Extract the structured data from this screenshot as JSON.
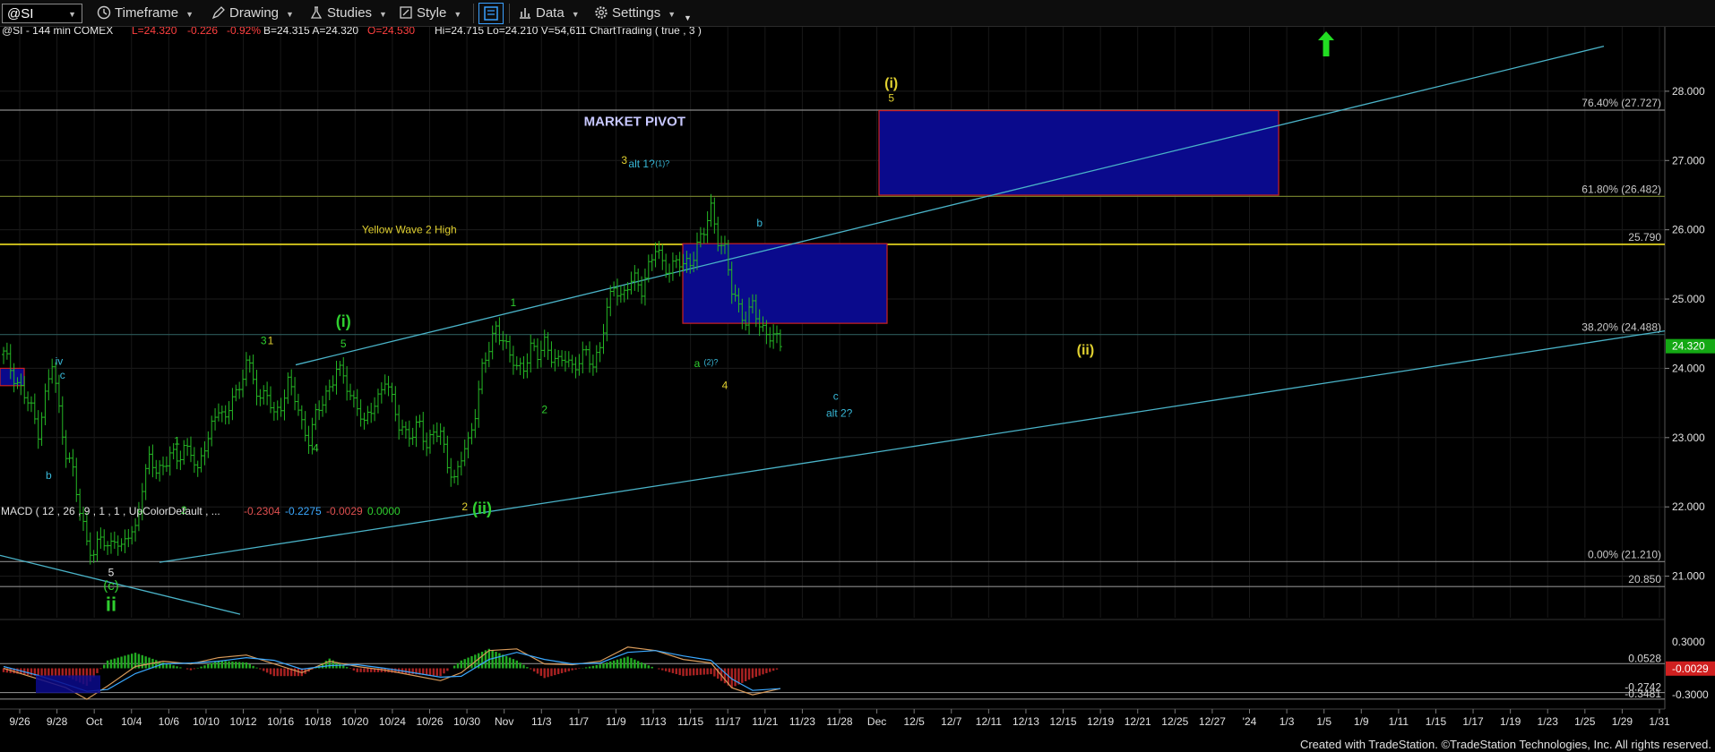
{
  "toolbar": {
    "symbol": "@SI",
    "timeframe": "Timeframe",
    "drawing": "Drawing",
    "studies": "Studies",
    "style": "Style",
    "data": "Data",
    "settings": "Settings"
  },
  "header": {
    "info": "@SI - 144 min  COMEX",
    "last": "L=24.320",
    "change": "-0.226",
    "pct": "-0.92%",
    "rest": "B=24.315  A=24.320",
    "open": "O=24.530",
    "tail": "Hi=24.715  Lo=24.210  V=54,611  ChartTrading ( true , 3 )"
  },
  "macd_header": {
    "label": "MACD ( 12 , 26 , 9 , 1 , 1 , UpColorDefault , ...",
    "v1": "-0.2304",
    "v2": "-0.2275",
    "v3": "-0.0029",
    "v4": "0.0000"
  },
  "footer": "Created with TradeStation. ©TradeStation Technologies, Inc. All rights reserved.",
  "colors": {
    "candle": "#25b825",
    "accent_yellow": "#f0e020",
    "pivot_fill": "#0a0a8c",
    "pivot_border": "#cc2222",
    "trendline": "#4ab3c8",
    "label_green": "#2fcf2f",
    "label_cyan": "#38b8d8",
    "label_yellow": "#e0d030"
  },
  "chart_data": {
    "type": "candlestick",
    "symbol": "@SI",
    "ylim": [
      20.4,
      28.8
    ],
    "y_ticks": [
      21.0,
      22.0,
      23.0,
      24.0,
      25.0,
      26.0,
      27.0,
      28.0
    ],
    "y_tick_labels": [
      "21.000",
      "22.000",
      "23.000",
      "24.000",
      "25.000",
      "26.000",
      "27.000",
      "28.000"
    ],
    "x_labels": [
      "9/26",
      "9/28",
      "Oct",
      "10/4",
      "10/6",
      "10/10",
      "10/12",
      "10/16",
      "10/18",
      "10/20",
      "10/24",
      "10/26",
      "10/30",
      "Nov",
      "11/3",
      "11/7",
      "11/9",
      "11/13",
      "11/15",
      "11/17",
      "11/21",
      "11/23",
      "11/28",
      "Dec",
      "12/5",
      "12/7",
      "12/11",
      "12/13",
      "12/15",
      "12/19",
      "12/21",
      "12/25",
      "12/27",
      "'24",
      "1/3",
      "1/5",
      "1/9",
      "1/11",
      "1/15",
      "1/17",
      "1/19",
      "1/23",
      "1/25",
      "1/29",
      "1/31"
    ],
    "price_path": [
      [
        0,
        24.2
      ],
      [
        2,
        24.0
      ],
      [
        4,
        23.8
      ],
      [
        6,
        23.6
      ],
      [
        8,
        23.4
      ],
      [
        10,
        23.1
      ],
      [
        12,
        23.6
      ],
      [
        14,
        24.05
      ],
      [
        16,
        23.4
      ],
      [
        18,
        22.8
      ],
      [
        20,
        22.5
      ],
      [
        22,
        21.9
      ],
      [
        24,
        21.55
      ],
      [
        26,
        21.3
      ],
      [
        28,
        21.55
      ],
      [
        30,
        21.4
      ],
      [
        32,
        21.6
      ],
      [
        34,
        21.35
      ],
      [
        36,
        21.6
      ],
      [
        38,
        21.7
      ],
      [
        40,
        22.3
      ],
      [
        42,
        22.65
      ],
      [
        44,
        22.55
      ],
      [
        46,
        22.6
      ],
      [
        48,
        22.75
      ],
      [
        50,
        22.65
      ],
      [
        52,
        22.9
      ],
      [
        54,
        22.8
      ],
      [
        56,
        22.45
      ],
      [
        58,
        22.9
      ],
      [
        60,
        23.2
      ],
      [
        62,
        23.4
      ],
      [
        64,
        23.2
      ],
      [
        66,
        23.7
      ],
      [
        68,
        23.65
      ],
      [
        70,
        24.1
      ],
      [
        72,
        23.85
      ],
      [
        74,
        23.6
      ],
      [
        76,
        23.6
      ],
      [
        78,
        23.3
      ],
      [
        80,
        23.5
      ],
      [
        82,
        23.8
      ],
      [
        84,
        23.55
      ],
      [
        86,
        23.2
      ],
      [
        88,
        23.0
      ],
      [
        90,
        23.3
      ],
      [
        92,
        23.5
      ],
      [
        94,
        23.75
      ],
      [
        96,
        24.0
      ],
      [
        98,
        23.85
      ],
      [
        100,
        23.6
      ],
      [
        102,
        23.5
      ],
      [
        104,
        23.15
      ],
      [
        106,
        23.4
      ],
      [
        108,
        23.6
      ],
      [
        110,
        23.85
      ],
      [
        112,
        23.5
      ],
      [
        114,
        23.2
      ],
      [
        116,
        23.1
      ],
      [
        118,
        23.0
      ],
      [
        120,
        23.2
      ],
      [
        122,
        22.9
      ],
      [
        124,
        23.1
      ],
      [
        126,
        23.0
      ],
      [
        128,
        22.65
      ],
      [
        130,
        22.4
      ],
      [
        132,
        22.7
      ],
      [
        134,
        22.9
      ],
      [
        136,
        23.4
      ],
      [
        138,
        24.0
      ],
      [
        140,
        24.25
      ],
      [
        142,
        24.6
      ],
      [
        144,
        24.45
      ],
      [
        146,
        24.15
      ],
      [
        148,
        24.0
      ],
      [
        150,
        24.05
      ],
      [
        152,
        24.3
      ],
      [
        154,
        24.15
      ],
      [
        156,
        24.4
      ],
      [
        158,
        24.2
      ],
      [
        160,
        24.05
      ],
      [
        162,
        24.15
      ],
      [
        164,
        24.05
      ],
      [
        166,
        24.1
      ],
      [
        168,
        24.2
      ],
      [
        170,
        24.05
      ],
      [
        172,
        24.35
      ],
      [
        174,
        24.8
      ],
      [
        176,
        25.2
      ],
      [
        178,
        25.05
      ],
      [
        180,
        25.2
      ],
      [
        182,
        25.25
      ],
      [
        184,
        25.15
      ],
      [
        186,
        25.5
      ],
      [
        188,
        25.7
      ],
      [
        190,
        25.5
      ],
      [
        192,
        25.45
      ],
      [
        194,
        25.55
      ],
      [
        196,
        25.45
      ],
      [
        198,
        25.55
      ],
      [
        200,
        25.8
      ],
      [
        202,
        25.95
      ],
      [
        204,
        26.3
      ],
      [
        206,
        25.9
      ],
      [
        208,
        25.7
      ],
      [
        210,
        25.1
      ],
      [
        212,
        24.9
      ],
      [
        214,
        24.7
      ],
      [
        216,
        24.9
      ],
      [
        218,
        24.6
      ],
      [
        220,
        24.55
      ],
      [
        222,
        24.45
      ],
      [
        224,
        24.32
      ]
    ],
    "bar_count": 225,
    "horizontal_levels": [
      {
        "price": 27.727,
        "label": "76.40% (27.727)",
        "color": "#8a8a8a"
      },
      {
        "price": 26.482,
        "label": "61.80% (26.482)",
        "color": "#6e7a2a"
      },
      {
        "price": 25.79,
        "label": "25.790",
        "color": "#f0e020"
      },
      {
        "price": 24.488,
        "label": "38.20% (24.488)",
        "color": "#2b5a5a"
      },
      {
        "price": 21.21,
        "label": "0.00% (21.210)",
        "color": "#8a8a8a"
      },
      {
        "price": 20.85,
        "label": "20.850",
        "color": "#8a8a8a"
      }
    ],
    "last_price": "24.320",
    "annotations": [
      {
        "text": "MARKET PIVOT",
        "color": "#c8c8ff",
        "size": 15,
        "bold": true,
        "price": 27.5,
        "bar": 182
      },
      {
        "text": "Yellow Wave 2 High",
        "color": "#e0d030",
        "size": 12,
        "price": 25.95,
        "bar": 117
      },
      {
        "text": "(i)",
        "color": "#e0d030",
        "size": 16,
        "bold": true,
        "price": 28.05,
        "bar": 256
      },
      {
        "text": "5",
        "color": "#e0d030",
        "size": 12,
        "price": 27.85,
        "bar": 256
      },
      {
        "text": "3",
        "color": "#e0d030",
        "size": 12,
        "price": 26.95,
        "bar": 179
      },
      {
        "text": "alt 1?",
        "color": "#38b8d8",
        "size": 12,
        "price": 26.9,
        "bar": 184
      },
      {
        "text": "(1)?",
        "color": "#38b8d8",
        "size": 9,
        "price": 26.92,
        "bar": 190
      },
      {
        "text": "b",
        "color": "#38b8d8",
        "size": 12,
        "price": 26.05,
        "bar": 218
      },
      {
        "text": "1",
        "color": "#2fcf2f",
        "size": 12,
        "price": 24.9,
        "bar": 147
      },
      {
        "text": "a",
        "color": "#2fcf2f",
        "size": 12,
        "price": 24.02,
        "bar": 200
      },
      {
        "text": "(2)?",
        "color": "#38b8d8",
        "size": 9,
        "price": 24.05,
        "bar": 204
      },
      {
        "text": "4",
        "color": "#e0d030",
        "size": 12,
        "price": 23.7,
        "bar": 208
      },
      {
        "text": "c",
        "color": "#38b8d8",
        "size": 12,
        "price": 23.55,
        "bar": 240
      },
      {
        "text": "alt 2?",
        "color": "#38b8d8",
        "size": 12,
        "price": 23.3,
        "bar": 241
      },
      {
        "text": "(ii)",
        "color": "#e0d030",
        "size": 16,
        "bold": true,
        "price": 24.2,
        "bar": 312
      },
      {
        "text": "2",
        "color": "#2fcf2f",
        "size": 12,
        "price": 23.35,
        "bar": 156
      },
      {
        "text": "2",
        "color": "#e0d030",
        "size": 12,
        "price": 21.95,
        "bar": 133
      },
      {
        "text": "(ii)",
        "color": "#2fcf2f",
        "size": 18,
        "bold": true,
        "price": 21.9,
        "bar": 138
      },
      {
        "text": "(i)",
        "color": "#2fcf2f",
        "size": 18,
        "bold": true,
        "price": 24.6,
        "bar": 98
      },
      {
        "text": "5",
        "color": "#2fcf2f",
        "size": 12,
        "price": 24.3,
        "bar": 98
      },
      {
        "text": "3",
        "color": "#2fcf2f",
        "size": 12,
        "price": 24.35,
        "bar": 75
      },
      {
        "text": "1",
        "color": "#e0d030",
        "size": 12,
        "price": 24.35,
        "bar": 77
      },
      {
        "text": "4",
        "color": "#2fcf2f",
        "size": 12,
        "price": 22.8,
        "bar": 90
      },
      {
        "text": "1",
        "color": "#2fcf2f",
        "size": 12,
        "price": 22.9,
        "bar": 50
      },
      {
        "text": "2",
        "color": "#2fcf2f",
        "size": 12,
        "price": 21.9,
        "bar": 52
      },
      {
        "text": "iv",
        "color": "#38b8d8",
        "size": 12,
        "price": 24.05,
        "bar": 16
      },
      {
        "text": "c",
        "color": "#38b8d8",
        "size": 12,
        "price": 23.85,
        "bar": 17
      },
      {
        "text": "b",
        "color": "#38b8d8",
        "size": 12,
        "price": 22.4,
        "bar": 13
      },
      {
        "text": "5",
        "color": "#e8e8e8",
        "size": 12,
        "price": 21.0,
        "bar": 31
      },
      {
        "text": "(c)",
        "color": "#2fcf2f",
        "size": 15,
        "price": 20.8,
        "bar": 31
      },
      {
        "text": "ii",
        "color": "#2fcf2f",
        "size": 22,
        "bold": true,
        "price": 20.5,
        "bar": 31
      }
    ],
    "macd": {
      "ylim": [
        -0.42,
        0.42
      ],
      "y_ticks": [
        0.3,
        -0.3
      ],
      "y_tick_labels": [
        "0.3000",
        "-0.3000"
      ],
      "levels": [
        {
          "value": 0.0528,
          "label": "0.0528"
        },
        {
          "value": -0.2742,
          "label": "-0.2742"
        },
        {
          "value": -0.3481,
          "label": "-0.3481"
        }
      ],
      "current": "-0.0029",
      "macd_line": [
        [
          0,
          0.0
        ],
        [
          10,
          -0.12
        ],
        [
          18,
          -0.22
        ],
        [
          24,
          -0.35
        ],
        [
          30,
          -0.2
        ],
        [
          38,
          0.02
        ],
        [
          46,
          0.08
        ],
        [
          54,
          0.05
        ],
        [
          62,
          0.12
        ],
        [
          70,
          0.15
        ],
        [
          78,
          0.05
        ],
        [
          86,
          -0.05
        ],
        [
          94,
          0.08
        ],
        [
          102,
          0.02
        ],
        [
          110,
          -0.02
        ],
        [
          118,
          -0.08
        ],
        [
          126,
          -0.14
        ],
        [
          132,
          -0.05
        ],
        [
          140,
          0.2
        ],
        [
          148,
          0.22
        ],
        [
          156,
          0.05
        ],
        [
          164,
          0.04
        ],
        [
          172,
          0.08
        ],
        [
          180,
          0.24
        ],
        [
          188,
          0.2
        ],
        [
          196,
          0.1
        ],
        [
          204,
          0.06
        ],
        [
          210,
          -0.22
        ],
        [
          216,
          -0.3
        ],
        [
          224,
          -0.23
        ]
      ],
      "signal_line": [
        [
          0,
          0.02
        ],
        [
          10,
          -0.08
        ],
        [
          18,
          -0.18
        ],
        [
          24,
          -0.26
        ],
        [
          30,
          -0.24
        ],
        [
          38,
          -0.06
        ],
        [
          46,
          0.05
        ],
        [
          54,
          0.06
        ],
        [
          62,
          0.08
        ],
        [
          70,
          0.12
        ],
        [
          78,
          0.09
        ],
        [
          86,
          -0.01
        ],
        [
          94,
          0.03
        ],
        [
          102,
          0.04
        ],
        [
          110,
          0.0
        ],
        [
          118,
          -0.05
        ],
        [
          126,
          -0.1
        ],
        [
          132,
          -0.09
        ],
        [
          140,
          0.1
        ],
        [
          148,
          0.18
        ],
        [
          156,
          0.1
        ],
        [
          164,
          0.05
        ],
        [
          172,
          0.06
        ],
        [
          180,
          0.18
        ],
        [
          188,
          0.2
        ],
        [
          196,
          0.14
        ],
        [
          204,
          0.09
        ],
        [
          210,
          -0.12
        ],
        [
          216,
          -0.25
        ],
        [
          224,
          -0.23
        ]
      ]
    }
  }
}
